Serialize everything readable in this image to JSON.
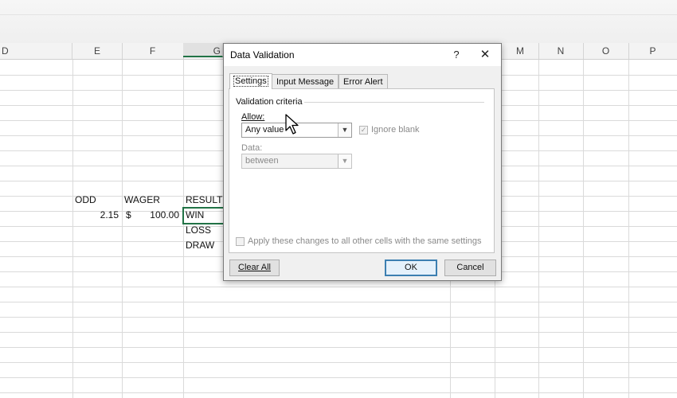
{
  "columns": [
    {
      "letter": "D",
      "selected": false
    },
    {
      "letter": "E",
      "selected": false
    },
    {
      "letter": "F",
      "selected": false
    },
    {
      "letter": "G",
      "selected": true
    },
    {
      "letter": "M",
      "selected": false
    },
    {
      "letter": "N",
      "selected": false
    },
    {
      "letter": "O",
      "selected": false
    },
    {
      "letter": "P",
      "selected": false
    }
  ],
  "sheet": {
    "headers": {
      "odd": "ODD",
      "wager": "WAGER",
      "result": "RESULT"
    },
    "row1": {
      "odd": "2.15",
      "currency": "$",
      "wager": "100.00",
      "result": "WIN"
    },
    "list": [
      "LOSS",
      "DRAW"
    ]
  },
  "dialog": {
    "title": "Data Validation",
    "help": "?",
    "close": "✕",
    "tabs": [
      "Settings",
      "Input Message",
      "Error Alert"
    ],
    "active_tab": "Settings",
    "group_label": "Validation criteria",
    "allow_label": "Allow:",
    "allow_value": "Any value",
    "ignore_blank_label": "Ignore blank",
    "ignore_blank_checked": true,
    "data_label": "Data:",
    "data_value": "between",
    "apply_label": "Apply these changes to all other cells with the same settings",
    "clear_all": "Clear All",
    "ok": "OK",
    "cancel": "Cancel"
  },
  "icons": {
    "help": "help-icon",
    "close": "close-icon",
    "dropdown": "chevron-down-icon",
    "cursor": "mouse-pointer-icon"
  },
  "colors": {
    "selection": "#217346",
    "default_button": "#3c7fb1"
  }
}
